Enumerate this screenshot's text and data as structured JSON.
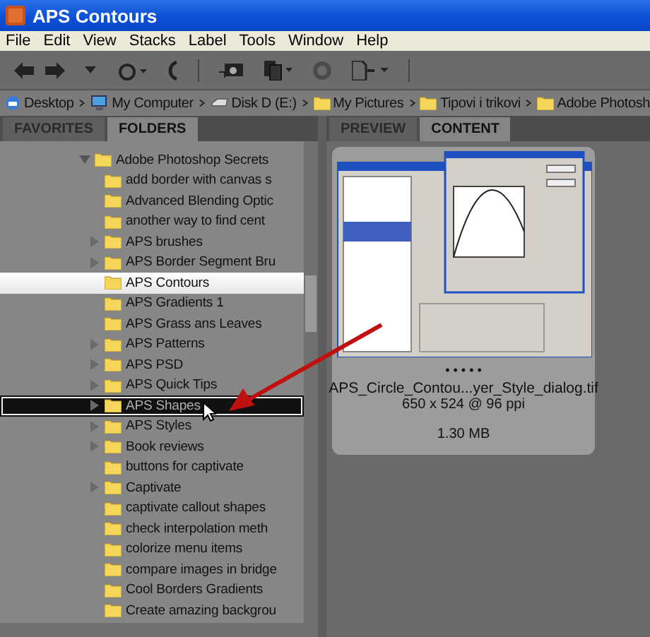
{
  "window": {
    "title": "APS Contours"
  },
  "menu": [
    "File",
    "Edit",
    "View",
    "Stacks",
    "Label",
    "Tools",
    "Window",
    "Help"
  ],
  "breadcrumbs": [
    {
      "label": "Desktop",
      "kind": "desktop"
    },
    {
      "label": "My Computer",
      "kind": "computer"
    },
    {
      "label": "Disk D (E:)",
      "kind": "disk"
    },
    {
      "label": "My Pictures",
      "kind": "folder"
    },
    {
      "label": "Tipovi i trikovi",
      "kind": "folder"
    },
    {
      "label": "Adobe Photosh",
      "kind": "folder"
    }
  ],
  "left_tabs": [
    {
      "label": "FAVORITES",
      "selected": false
    },
    {
      "label": "FOLDERS",
      "selected": true
    }
  ],
  "right_tabs": [
    {
      "label": "PREVIEW",
      "selected": false
    },
    {
      "label": "CONTENT",
      "selected": true
    }
  ],
  "folder_tree": [
    {
      "label": "Adobe Photoshop Secrets",
      "expanded": true,
      "children": [
        {
          "label": "add border with canvas s",
          "has_children": false,
          "selected": false,
          "drop_target": false
        },
        {
          "label": "Advanced Blending Optic",
          "has_children": false,
          "selected": false,
          "drop_target": false
        },
        {
          "label": "another way to find cent",
          "has_children": false,
          "selected": false,
          "drop_target": false
        },
        {
          "label": "APS  brushes",
          "has_children": true,
          "selected": false,
          "drop_target": false
        },
        {
          "label": "APS Border Segment Bru",
          "has_children": true,
          "selected": false,
          "drop_target": false
        },
        {
          "label": "APS Contours",
          "has_children": false,
          "selected": true,
          "drop_target": false
        },
        {
          "label": "APS Gradients 1",
          "has_children": false,
          "selected": false,
          "drop_target": false
        },
        {
          "label": "APS Grass ans Leaves",
          "has_children": false,
          "selected": false,
          "drop_target": false
        },
        {
          "label": "APS Patterns",
          "has_children": true,
          "selected": false,
          "drop_target": false
        },
        {
          "label": "APS PSD",
          "has_children": true,
          "selected": false,
          "drop_target": false
        },
        {
          "label": "APS Quick Tips",
          "has_children": true,
          "selected": false,
          "drop_target": false
        },
        {
          "label": "APS Shapes",
          "has_children": true,
          "selected": false,
          "drop_target": true
        },
        {
          "label": "APS Styles",
          "has_children": true,
          "selected": false,
          "drop_target": false
        },
        {
          "label": "Book reviews",
          "has_children": true,
          "selected": false,
          "drop_target": false
        },
        {
          "label": "buttons for captivate",
          "has_children": false,
          "selected": false,
          "drop_target": false
        },
        {
          "label": "Captivate",
          "has_children": true,
          "selected": false,
          "drop_target": false
        },
        {
          "label": "captivate callout shapes",
          "has_children": false,
          "selected": false,
          "drop_target": false
        },
        {
          "label": "check interpolation meth",
          "has_children": false,
          "selected": false,
          "drop_target": false
        },
        {
          "label": "colorize menu items",
          "has_children": false,
          "selected": false,
          "drop_target": false
        },
        {
          "label": "compare images in bridge",
          "has_children": false,
          "selected": false,
          "drop_target": false
        },
        {
          "label": "Cool Borders Gradients",
          "has_children": false,
          "selected": false,
          "drop_target": false
        },
        {
          "label": "Create amazing backgrou",
          "has_children": false,
          "selected": false,
          "drop_target": false
        }
      ]
    }
  ],
  "thumbnail": {
    "rating": "• • • • •",
    "filename": "APS_Circle_Contou...yer_Style_dialog.tif",
    "dimensions": "650 x 524 @ 96 ppi",
    "size": "1.30 MB",
    "selected": true
  }
}
